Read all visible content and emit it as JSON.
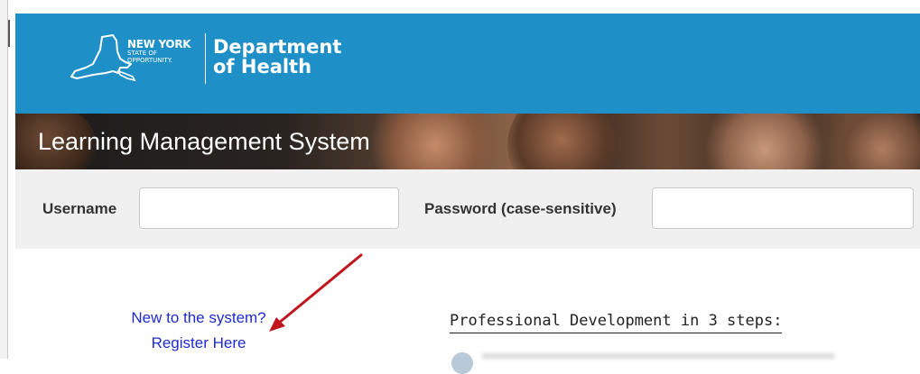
{
  "header": {
    "logo": {
      "line1": "NEW YORK",
      "line2": "STATE OF",
      "line3": "OPPORTUNITY.",
      "department": "Department",
      "department_line2": "of Health"
    }
  },
  "banner": {
    "title": "Learning Management System"
  },
  "login": {
    "username_label": "Username",
    "username_value": "",
    "password_label": "Password (case-sensitive)",
    "password_value": ""
  },
  "register": {
    "line1": "New to the system?",
    "line2": "Register Here"
  },
  "professional_development": {
    "title": "Professional Development in 3 steps:"
  },
  "colors": {
    "header_blue": "#1f8fc8",
    "link_blue": "#1e2bd0",
    "arrow_red": "#c0161e"
  }
}
